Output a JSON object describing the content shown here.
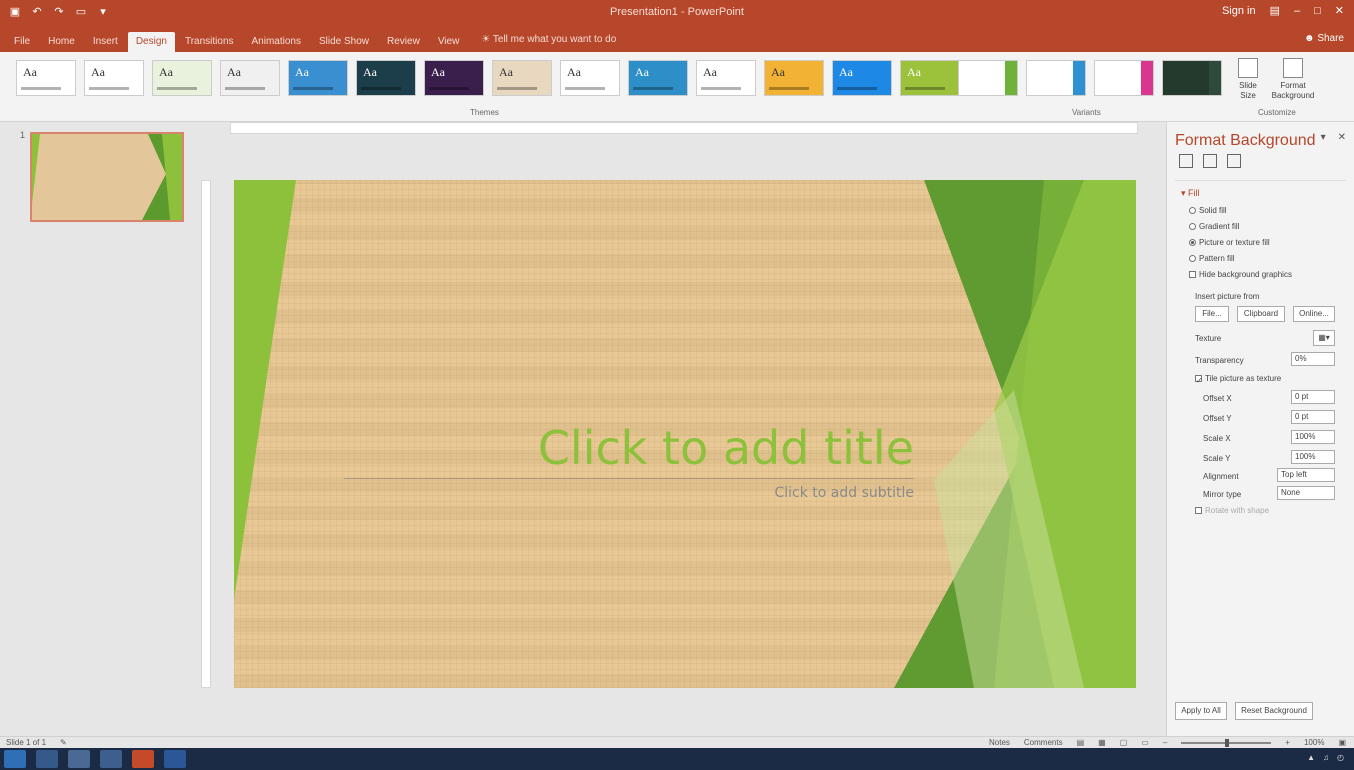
{
  "window": {
    "title": "Presentation1 - PowerPoint",
    "sign_in": "Sign in",
    "share": "Share"
  },
  "ribbon_tabs": [
    "File",
    "Home",
    "Insert",
    "Design",
    "Transitions",
    "Animations",
    "Slide Show",
    "Review",
    "View"
  ],
  "tell_me": "Tell me what you want to do",
  "ribbon": {
    "themes_label": "Themes",
    "variants_label": "Variants",
    "customize_label": "Customize",
    "slide_size": "Slide Size",
    "format_background": "Format Background",
    "theme_text": "Aa",
    "theme_colors": [
      "#ffffff",
      "#ffffff",
      "#e9f2dc",
      "#f0f0f0",
      "#3a8fd0",
      "#1c3d4a",
      "#3a1f4d",
      "#e8d8c0",
      "#ffffff",
      "#2e8fc8",
      "#ffffff",
      "#f2b233",
      "#1e88e5",
      "#9cc23b"
    ],
    "variant_accents": [
      "#6fb23a",
      "#2e90d1",
      "#d8368f",
      "#2f4a3a"
    ]
  },
  "slide_panel": {
    "slide_number": "1"
  },
  "slide": {
    "title_placeholder": "Click to add title",
    "subtitle_placeholder": "Click to add subtitle",
    "accent_color": "#8dc03b"
  },
  "format_pane": {
    "title": "Format Background",
    "section": "Fill",
    "fill_options": [
      "Solid fill",
      "Gradient fill",
      "Picture or texture fill",
      "Pattern fill"
    ],
    "hide_graphics": "Hide background graphics",
    "insert_picture_from": "Insert picture from",
    "file_btn": "File...",
    "clipboard_btn": "Clipboard",
    "online_btn": "Online...",
    "texture_label": "Texture",
    "transparency_label": "Transparency",
    "transparency_value": "0%",
    "tile_label": "Tile picture as texture",
    "offset_x_label": "Offset X",
    "offset_x_value": "0 pt",
    "offset_y_label": "Offset Y",
    "offset_y_value": "0 pt",
    "scale_x_label": "Scale X",
    "scale_x_value": "100%",
    "scale_y_label": "Scale Y",
    "scale_y_value": "100%",
    "alignment_label": "Alignment",
    "alignment_value": "Top left",
    "mirror_label": "Mirror type",
    "mirror_value": "None",
    "rotate_label": "Rotate with shape",
    "apply_all": "Apply to All",
    "reset": "Reset Background"
  },
  "status": {
    "slide_of": "Slide 1 of 1",
    "notes": "Notes",
    "comments": "Comments",
    "zoom": "100%"
  }
}
